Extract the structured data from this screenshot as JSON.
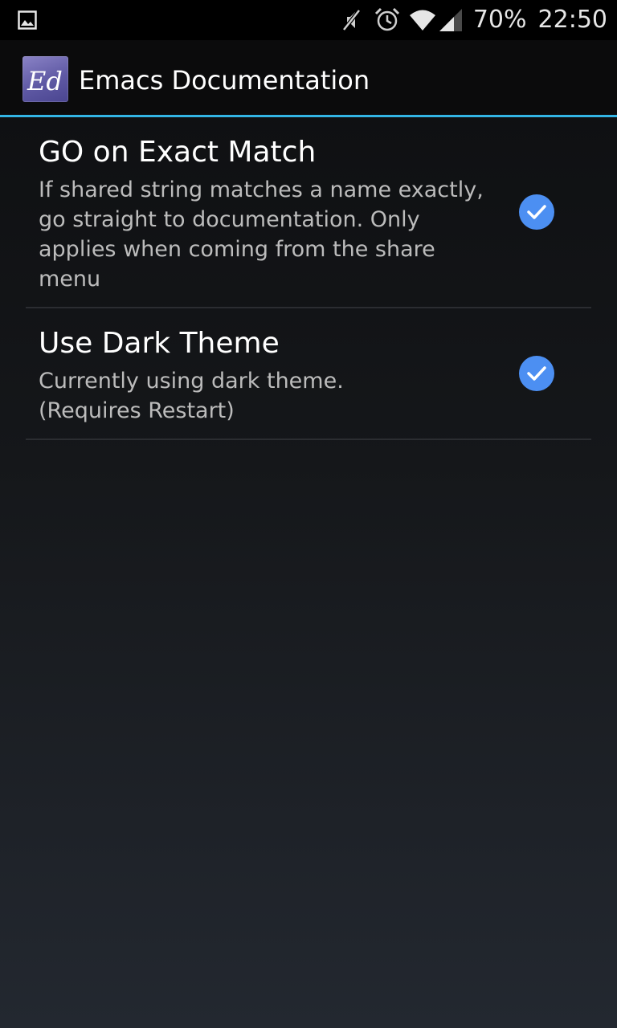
{
  "status_bar": {
    "battery_percent": "70%",
    "time": "22:50",
    "icons": [
      "image-notification-icon",
      "mute-icon",
      "alarm-icon",
      "wifi-icon",
      "signal-icon"
    ]
  },
  "action_bar": {
    "title": "Emacs Documentation",
    "app_icon_text": "Ed"
  },
  "preferences": [
    {
      "title": "GO on Exact Match",
      "summary": "If shared string matches a name exactly, go straight to documentation. Only applies when coming from the share menu",
      "checked": true
    },
    {
      "title": "Use Dark Theme",
      "summary": "Currently using dark theme. (Requires Restart)",
      "checked": true
    }
  ],
  "colors": {
    "accent": "#33b5e5",
    "checkbox": "#4c8ff2"
  }
}
